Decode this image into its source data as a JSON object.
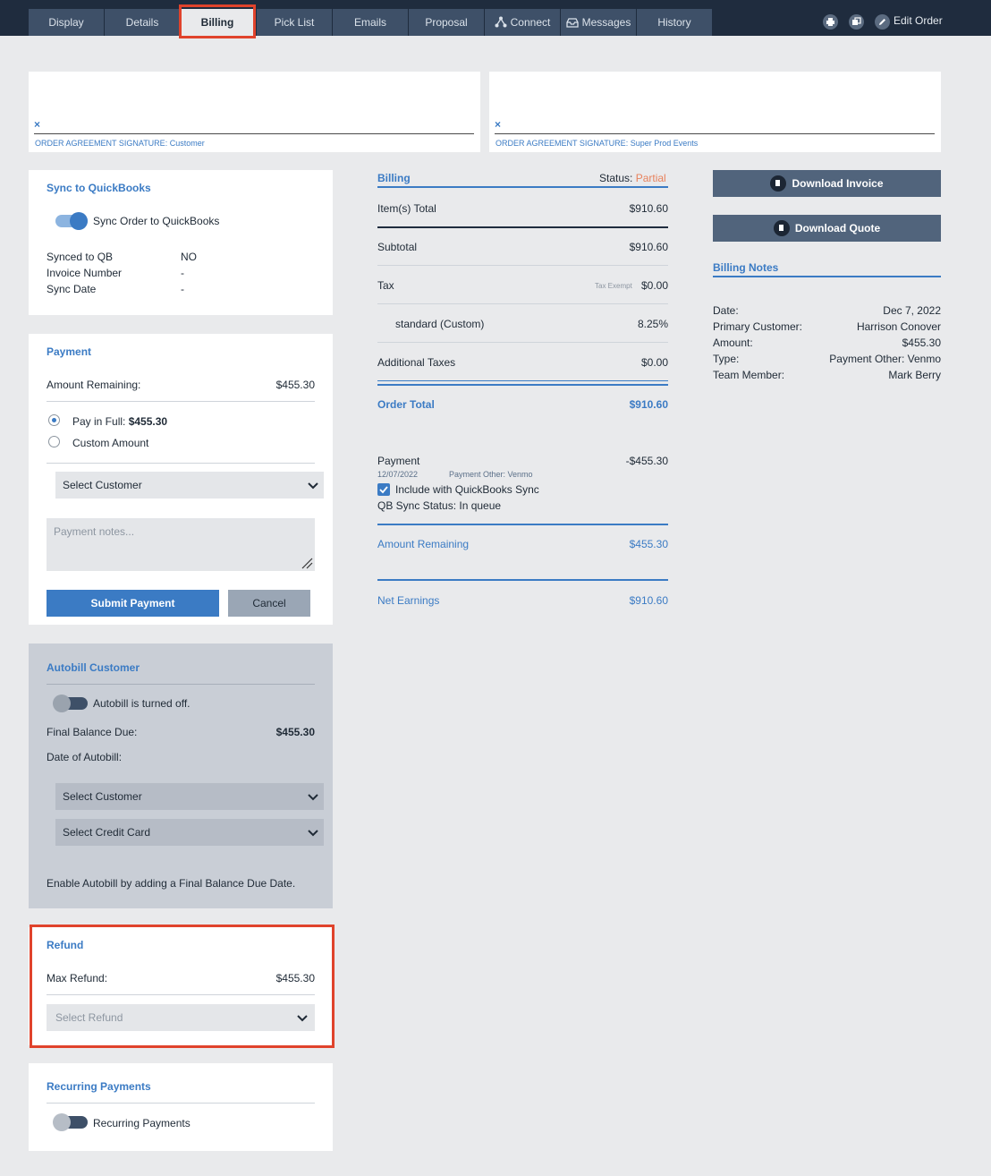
{
  "tabs": [
    {
      "label": "Display"
    },
    {
      "label": "Details"
    },
    {
      "label": "Billing"
    },
    {
      "label": "Pick List"
    },
    {
      "label": "Emails"
    },
    {
      "label": "Proposal"
    },
    {
      "label": "Connect"
    },
    {
      "label": "Messages"
    },
    {
      "label": "History"
    }
  ],
  "header": {
    "edit_order": "Edit Order"
  },
  "signatures": {
    "customer_caption": "ORDER AGREEMENT SIGNATURE: Customer",
    "company_caption": "ORDER AGREEMENT SIGNATURE: Super Prod Events",
    "clear": "×"
  },
  "quickbooks": {
    "title": "Sync to QuickBooks",
    "toggle_label": "Sync Order to QuickBooks",
    "rows": [
      {
        "label": "Synced to QB",
        "value": "NO"
      },
      {
        "label": "Invoice Number",
        "value": "-"
      },
      {
        "label": "Sync Date",
        "value": "-"
      }
    ]
  },
  "payment": {
    "title": "Payment",
    "remaining_label": "Amount Remaining:",
    "remaining_value": "$455.30",
    "pay_full_label": "Pay in Full: ",
    "pay_full_amount": "$455.30",
    "custom_label": "Custom Amount",
    "customer_select": "Select Customer",
    "notes_placeholder": "Payment notes...",
    "submit": "Submit Payment",
    "cancel": "Cancel"
  },
  "autobill": {
    "title": "Autobill Customer",
    "toggle_label": "Autobill is turned off.",
    "final_label": "Final Balance Due:",
    "final_value": "$455.30",
    "date_label": "Date of Autobill:",
    "customer_select": "Select Customer",
    "card_select": "Select Credit Card",
    "hint": "Enable Autobill by adding a Final Balance Due Date."
  },
  "refund": {
    "title": "Refund",
    "max_label": "Max Refund:",
    "max_value": "$455.30",
    "select": "Select Refund"
  },
  "recurring": {
    "title": "Recurring Payments",
    "toggle_label": "Recurring Payments"
  },
  "billing": {
    "title": "Billing",
    "status_label": "Status: ",
    "status_value": "Partial",
    "items_label": "Item(s) Total",
    "items_value": "$910.60",
    "subtotal_label": "Subtotal",
    "subtotal_value": "$910.60",
    "tax_label": "Tax",
    "tax_exempt": "Tax Exempt",
    "tax_value": "$0.00",
    "standard_label": "standard (Custom)",
    "standard_value": "8.25%",
    "additional_label": "Additional Taxes",
    "additional_value": "$0.00",
    "order_total_label": "Order Total",
    "order_total_value": "$910.60",
    "payment_label": "Payment",
    "payment_value": "-$455.30",
    "payment_date": "12/07/2022",
    "payment_method": "Payment Other: Venmo",
    "include_sync": "Include with QuickBooks Sync",
    "qb_status": "QB Sync Status: In queue",
    "remaining_label": "Amount Remaining",
    "remaining_value": "$455.30",
    "net_label": "Net Earnings",
    "net_value": "$910.60"
  },
  "downloads": {
    "invoice": "Download Invoice",
    "quote": "Download Quote"
  },
  "notes": {
    "title": "Billing Notes",
    "rows": [
      {
        "label": "Date:",
        "value": "Dec 7, 2022"
      },
      {
        "label": "Primary Customer:",
        "value": "Harrison Conover"
      },
      {
        "label": "Amount:",
        "value": "$455.30"
      },
      {
        "label": "Type:",
        "value": "Payment Other: Venmo"
      },
      {
        "label": "Team Member:",
        "value": "Mark Berry"
      }
    ]
  },
  "colors": {
    "accent": "#3b7bc4",
    "navbar": "#1f2c3e",
    "highlight": "#e0432c",
    "status_partial": "#e8825c"
  }
}
